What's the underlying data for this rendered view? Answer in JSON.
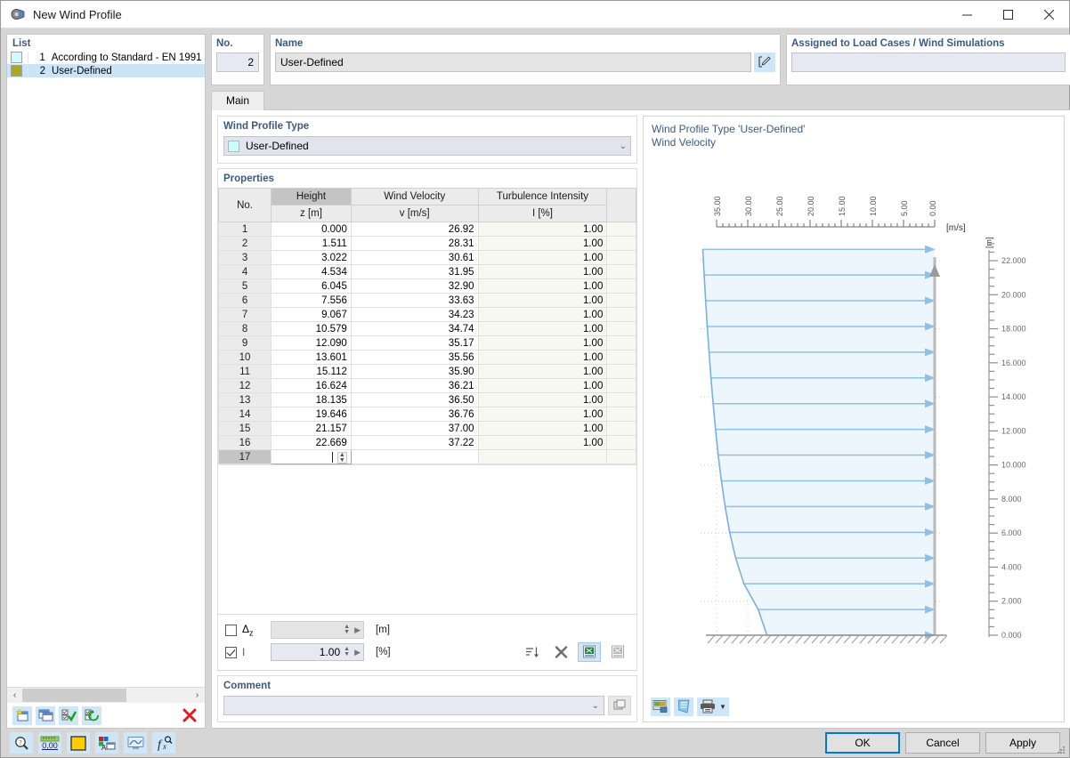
{
  "window": {
    "title": "New Wind Profile",
    "icon": "wind-profile-icon",
    "minimize": "—",
    "maximize": "☐",
    "close": "✕"
  },
  "list_panel": {
    "title": "List",
    "items": [
      {
        "no": "1",
        "label": "According to Standard - EN 1991 |",
        "color": "#ccfcfc",
        "selected": false
      },
      {
        "no": "2",
        "label": "User-Defined",
        "color": "#a8a82c",
        "selected": true
      }
    ],
    "scroll_left": "‹",
    "scroll_right": "›",
    "toolbar": [
      {
        "name": "new-item-button",
        "glyph": "new"
      },
      {
        "name": "copy-item-button",
        "glyph": "copy"
      },
      {
        "name": "check-all-button",
        "glyph": "check"
      },
      {
        "name": "toggle-check-button",
        "glyph": "toggle"
      },
      {
        "name": "delete-item-button",
        "glyph": "delete"
      }
    ]
  },
  "header": {
    "no_label": "No.",
    "no_value": "2",
    "name_label": "Name",
    "name_value": "User-Defined",
    "name_edit_icon": "edit-pencil-icon",
    "assigned_label": "Assigned to Load Cases / Wind Simulations",
    "assigned_value": ""
  },
  "tabs": [
    {
      "label": "Main",
      "active": true
    }
  ],
  "profile_type": {
    "group_title": "Wind Profile Type",
    "selected": "User-Defined",
    "swatch_color": "#ccfcfc",
    "chevron": "⌄"
  },
  "properties": {
    "group_title": "Properties",
    "columns": [
      {
        "header1": "No.",
        "header2": ""
      },
      {
        "header1": "Height",
        "header2": "z [m]"
      },
      {
        "header1": "Wind Velocity",
        "header2": "v [m/s]"
      },
      {
        "header1": "Turbulence Intensity",
        "header2": "I [%]"
      },
      {
        "header1": "",
        "header2": ""
      }
    ],
    "rows": [
      {
        "no": "1",
        "z": "0.000",
        "v": "26.92",
        "i": "1.00"
      },
      {
        "no": "2",
        "z": "1.511",
        "v": "28.31",
        "i": "1.00"
      },
      {
        "no": "3",
        "z": "3.022",
        "v": "30.61",
        "i": "1.00"
      },
      {
        "no": "4",
        "z": "4.534",
        "v": "31.95",
        "i": "1.00"
      },
      {
        "no": "5",
        "z": "6.045",
        "v": "32.90",
        "i": "1.00"
      },
      {
        "no": "6",
        "z": "7.556",
        "v": "33.63",
        "i": "1.00"
      },
      {
        "no": "7",
        "z": "9.067",
        "v": "34.23",
        "i": "1.00"
      },
      {
        "no": "8",
        "z": "10.579",
        "v": "34.74",
        "i": "1.00"
      },
      {
        "no": "9",
        "z": "12.090",
        "v": "35.17",
        "i": "1.00"
      },
      {
        "no": "10",
        "z": "13.601",
        "v": "35.56",
        "i": "1.00"
      },
      {
        "no": "11",
        "z": "15.112",
        "v": "35.90",
        "i": "1.00"
      },
      {
        "no": "12",
        "z": "16.624",
        "v": "36.21",
        "i": "1.00"
      },
      {
        "no": "13",
        "z": "18.135",
        "v": "36.50",
        "i": "1.00"
      },
      {
        "no": "14",
        "z": "19.646",
        "v": "36.76",
        "i": "1.00"
      },
      {
        "no": "15",
        "z": "21.157",
        "v": "37.00",
        "i": "1.00"
      },
      {
        "no": "16",
        "z": "22.669",
        "v": "37.22",
        "i": "1.00"
      }
    ],
    "edit_row": {
      "no": "17",
      "z": "",
      "v": "",
      "i": ""
    }
  },
  "options": {
    "delta_z": {
      "label": "Δ",
      "sub": "z",
      "checked": false,
      "value": "",
      "unit": "[m]",
      "enabled": false
    },
    "intensity": {
      "label": "I",
      "checked": true,
      "value": "1.00",
      "unit": "[%]",
      "enabled": true
    },
    "buttons": [
      {
        "name": "sort-table-button",
        "glyph": "sort",
        "highlight": false
      },
      {
        "name": "clear-table-button",
        "glyph": "x",
        "highlight": false
      },
      {
        "name": "import-excel-button",
        "glyph": "excel-in",
        "highlight": true
      },
      {
        "name": "export-excel-button",
        "glyph": "excel-out",
        "highlight": false
      }
    ]
  },
  "comment": {
    "group_title": "Comment",
    "value": "",
    "chevron": "⌄",
    "button_name": "comment-library-button"
  },
  "chart_panel": {
    "title_line1": "Wind Profile Type 'User-Defined'",
    "title_line2": "Wind Velocity",
    "toolbar": [
      {
        "name": "chart-image-button",
        "glyph": "image"
      },
      {
        "name": "chart-report-button",
        "glyph": "report"
      },
      {
        "name": "chart-print-button",
        "glyph": "print"
      },
      {
        "name": "chart-print-dropdown",
        "glyph": "caret"
      }
    ]
  },
  "chart_data": {
    "type": "line",
    "title": "Wind Velocity",
    "subtitle": "Wind Profile Type 'User-Defined'",
    "xlabel": "[m/s]",
    "ylabel": "[m]",
    "x_ticks": [
      "35.00",
      "30.00",
      "25.00",
      "20.00",
      "15.00",
      "10.00",
      "5.00",
      "0.00"
    ],
    "x_tick_values": [
      35,
      30,
      25,
      20,
      15,
      10,
      5,
      0
    ],
    "xlim": [
      35,
      0
    ],
    "x_reversed": true,
    "y_ticks": [
      "22.000",
      "20.000",
      "18.000",
      "16.000",
      "14.000",
      "12.000",
      "10.000",
      "8.000",
      "6.000",
      "4.000",
      "2.000",
      "0.000"
    ],
    "y_tick_values": [
      22,
      20,
      18,
      16,
      14,
      12,
      10,
      8,
      6,
      4,
      2,
      0
    ],
    "ylim": [
      0,
      23.5
    ],
    "grid": true,
    "legend": "none",
    "series": [
      {
        "name": "Wind Velocity",
        "z": [
          0.0,
          1.511,
          3.022,
          4.534,
          6.045,
          7.556,
          9.067,
          10.579,
          12.09,
          13.601,
          15.112,
          16.624,
          18.135,
          19.646,
          21.157,
          22.669
        ],
        "v": [
          26.92,
          28.31,
          30.61,
          31.95,
          32.9,
          33.63,
          34.23,
          34.74,
          35.17,
          35.56,
          35.9,
          36.21,
          36.5,
          36.76,
          37.0,
          37.22
        ]
      }
    ],
    "line_color": "#7ab0e0",
    "fill_color": "#eaf4fc",
    "arrow_color": "#8fc0e8"
  },
  "footer": {
    "tools": [
      {
        "name": "info-button",
        "glyph": "magnifier"
      },
      {
        "name": "units-button",
        "glyph": "ruler"
      },
      {
        "name": "color-button",
        "glyph": "color"
      },
      {
        "name": "display-properties-button",
        "glyph": "palette"
      },
      {
        "name": "view-button",
        "glyph": "view"
      },
      {
        "name": "formula-button",
        "glyph": "formula"
      }
    ],
    "ok": "OK",
    "cancel": "Cancel",
    "apply": "Apply"
  }
}
